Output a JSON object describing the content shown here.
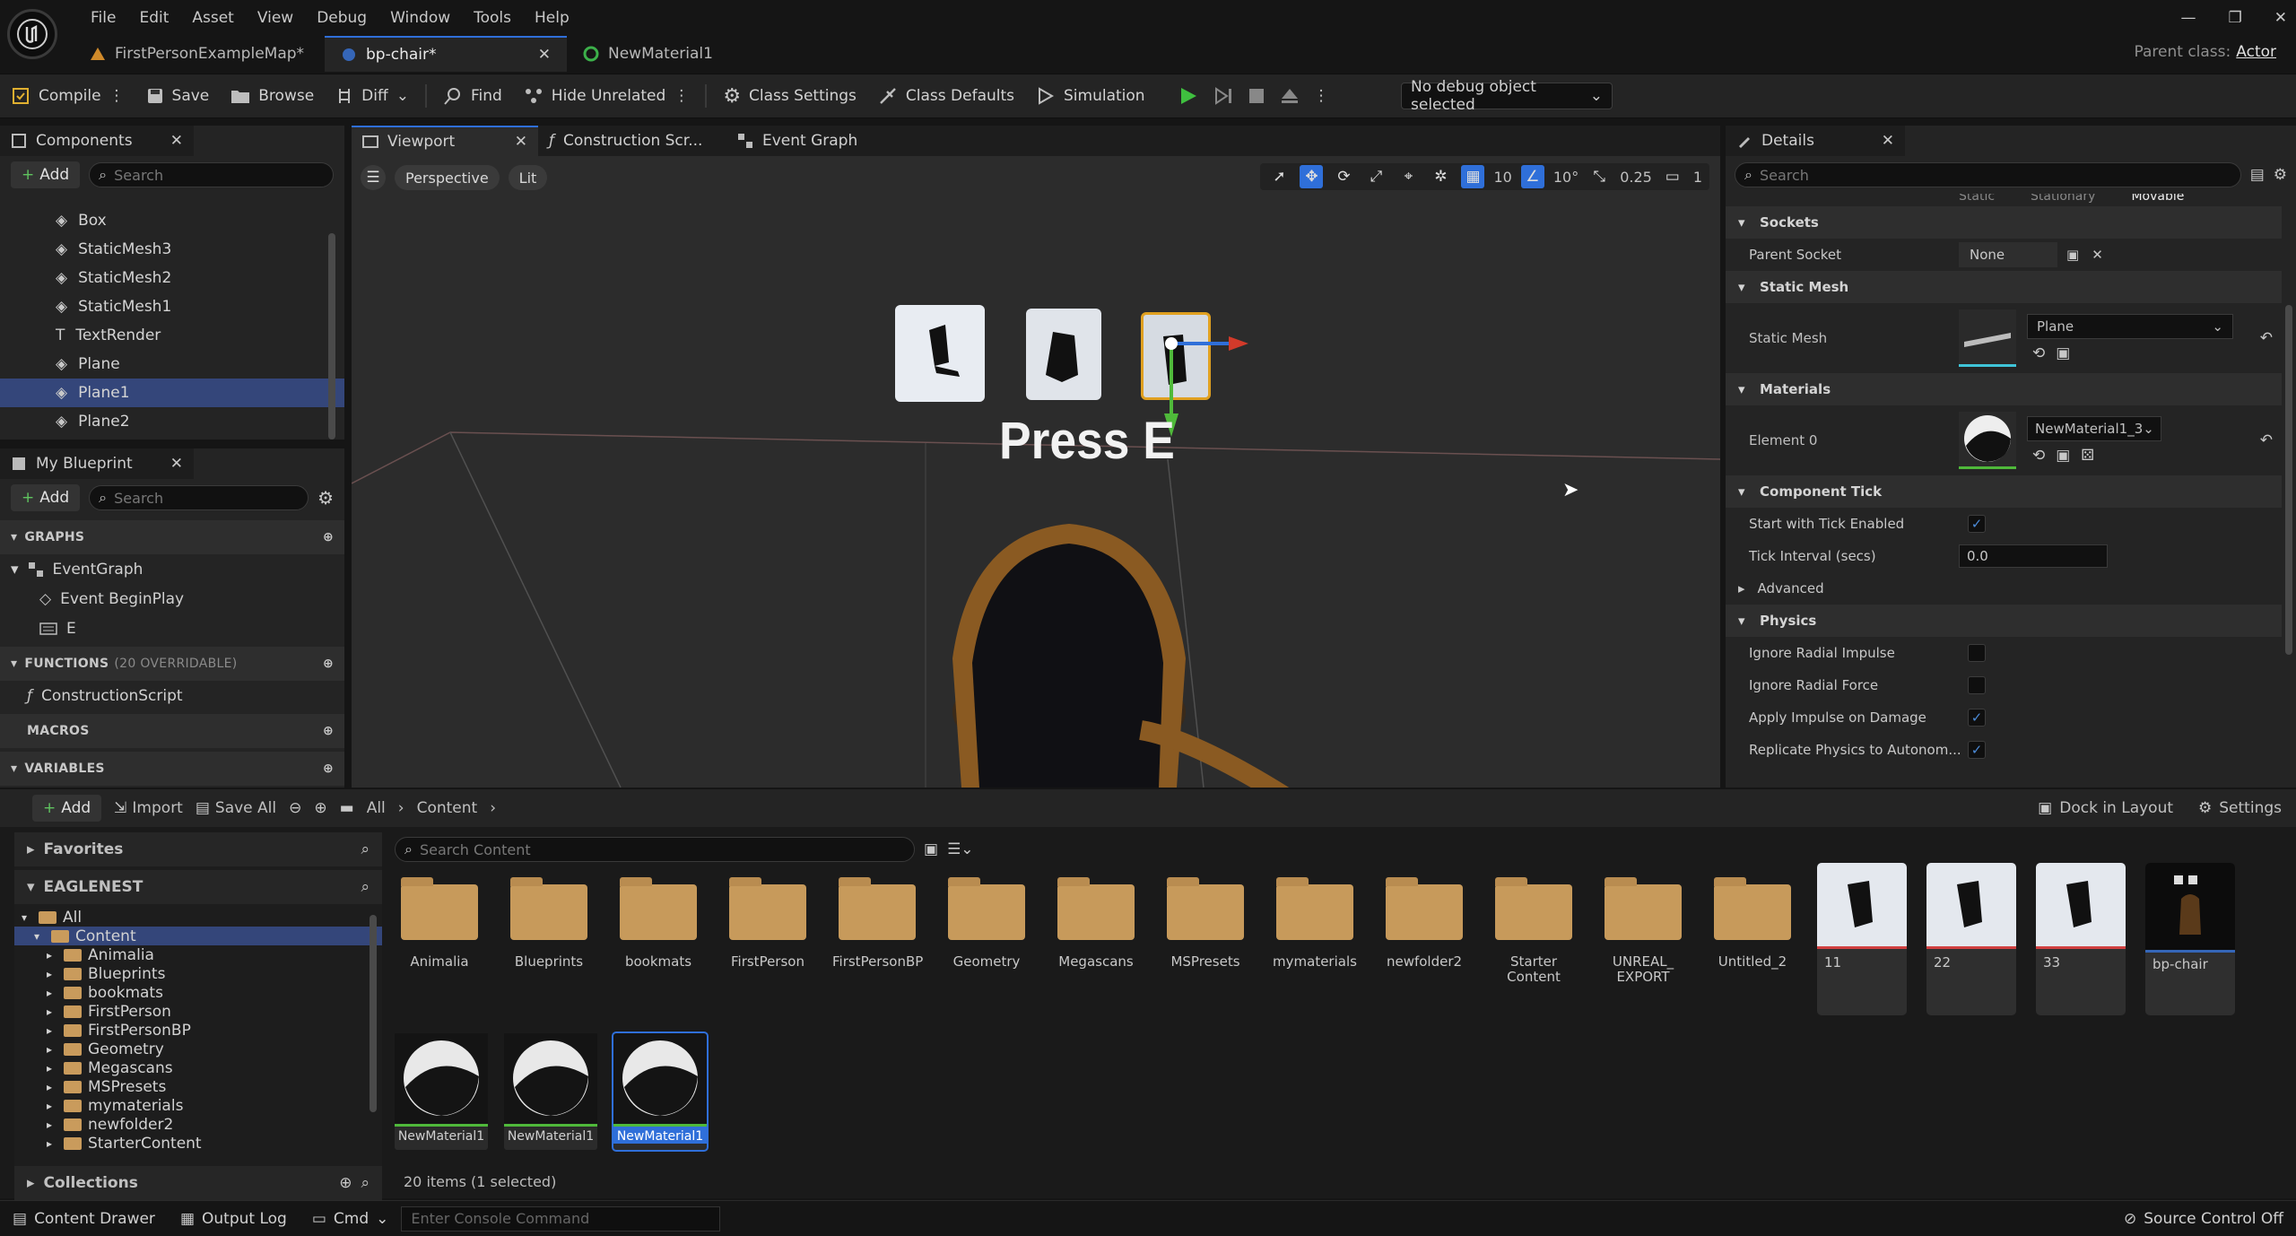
{
  "menu": [
    "File",
    "Edit",
    "Asset",
    "View",
    "Debug",
    "Window",
    "Tools",
    "Help"
  ],
  "tabs": [
    {
      "label": "FirstPersonExampleMap*"
    },
    {
      "label": "bp-chair*"
    },
    {
      "label": "NewMaterial1"
    }
  ],
  "parent_class": {
    "label": "Parent class:",
    "value": "Actor"
  },
  "toolbar": {
    "compile": "Compile",
    "save": "Save",
    "browse": "Browse",
    "diff": "Diff",
    "find": "Find",
    "hide_unrelated": "Hide Unrelated",
    "class_settings": "Class Settings",
    "class_defaults": "Class Defaults",
    "simulation": "Simulation",
    "debug_object": "No debug object selected"
  },
  "components": {
    "tab": "Components",
    "add": "Add",
    "search_placeholder": "Search",
    "items": [
      "Box",
      "StaticMesh3",
      "StaticMesh2",
      "StaticMesh1",
      "TextRender",
      "Plane",
      "Plane1",
      "Plane2"
    ]
  },
  "my_blueprint": {
    "tab": "My Blueprint",
    "add": "Add",
    "search_placeholder": "Search",
    "graphs_header": "GRAPHS",
    "event_graph": "EventGraph",
    "event_begin_play": "Event BeginPlay",
    "e_event": "E",
    "functions_header": "FUNCTIONS",
    "functions_overridable": "(20 OVERRIDABLE)",
    "construction_script": "ConstructionScript",
    "macros_header": "MACROS",
    "variables_header": "VARIABLES"
  },
  "editor_tabs": {
    "viewport": "Viewport",
    "construction": "Construction Scr...",
    "event_graph": "Event Graph"
  },
  "viewport": {
    "perspective": "Perspective",
    "lit": "Lit",
    "grid_snap": "10",
    "rot_snap": "10°",
    "scale_snap": "0.25",
    "camera_speed": "1",
    "text_render": "Press E"
  },
  "details": {
    "tab": "Details",
    "search_placeholder": "Search",
    "mobility_partial": [
      "Static",
      "Stationary",
      "Movable"
    ],
    "sockets_header": "Sockets",
    "parent_socket_label": "Parent Socket",
    "parent_socket_value": "None",
    "static_mesh_header": "Static Mesh",
    "static_mesh_label": "Static Mesh",
    "static_mesh_value": "Plane",
    "materials_header": "Materials",
    "element0_label": "Element 0",
    "element0_value": "NewMaterial1_3",
    "component_tick_header": "Component Tick",
    "start_tick_label": "Start with Tick Enabled",
    "tick_interval_label": "Tick Interval (secs)",
    "tick_interval_value": "0.0",
    "advanced_label": "Advanced",
    "physics_header": "Physics",
    "ignore_radial_impulse": "Ignore Radial Impulse",
    "ignore_radial_force": "Ignore Radial Force",
    "apply_impulse_damage": "Apply Impulse on Damage",
    "replicate_physics": "Replicate Physics to Autonom..."
  },
  "content_browser": {
    "add": "Add",
    "import": "Import",
    "save_all": "Save All",
    "breadcrumb": [
      "All",
      "Content"
    ],
    "dock_in_layout": "Dock in Layout",
    "settings": "Settings",
    "favorites": "Favorites",
    "project": "EAGLENEST",
    "search_placeholder": "Search Content",
    "tree": [
      "All",
      "Content",
      "Animalia",
      "Blueprints",
      "bookmats",
      "FirstPerson",
      "FirstPersonBP",
      "Geometry",
      "Megascans",
      "MSPresets",
      "mymaterials",
      "newfolder2",
      "StarterContent"
    ],
    "collections": "Collections",
    "folders": [
      "Animalia",
      "Blueprints",
      "bookmats",
      "FirstPerson",
      "FirstPersonBP",
      "Geometry",
      "Megascans",
      "MSPresets",
      "mymaterials",
      "newfolder2",
      "Starter Content",
      "UNREAL_ EXPORT",
      "Untitled_2"
    ],
    "textures": [
      "11",
      "22",
      "33"
    ],
    "blueprint": "bp-chair",
    "materials": [
      "NewMaterial1",
      "NewMaterial1",
      "NewMaterial1"
    ],
    "status": "20 items (1 selected)"
  },
  "statusbar": {
    "content_drawer": "Content Drawer",
    "output_log": "Output Log",
    "cmd": "Cmd",
    "console_placeholder": "Enter Console Command",
    "source_control": "Source Control Off"
  },
  "colors": {
    "accent": "#2f6fd9",
    "selection": "#34467a",
    "folder": "#c79a5b",
    "play_green": "#3fbf3f"
  }
}
